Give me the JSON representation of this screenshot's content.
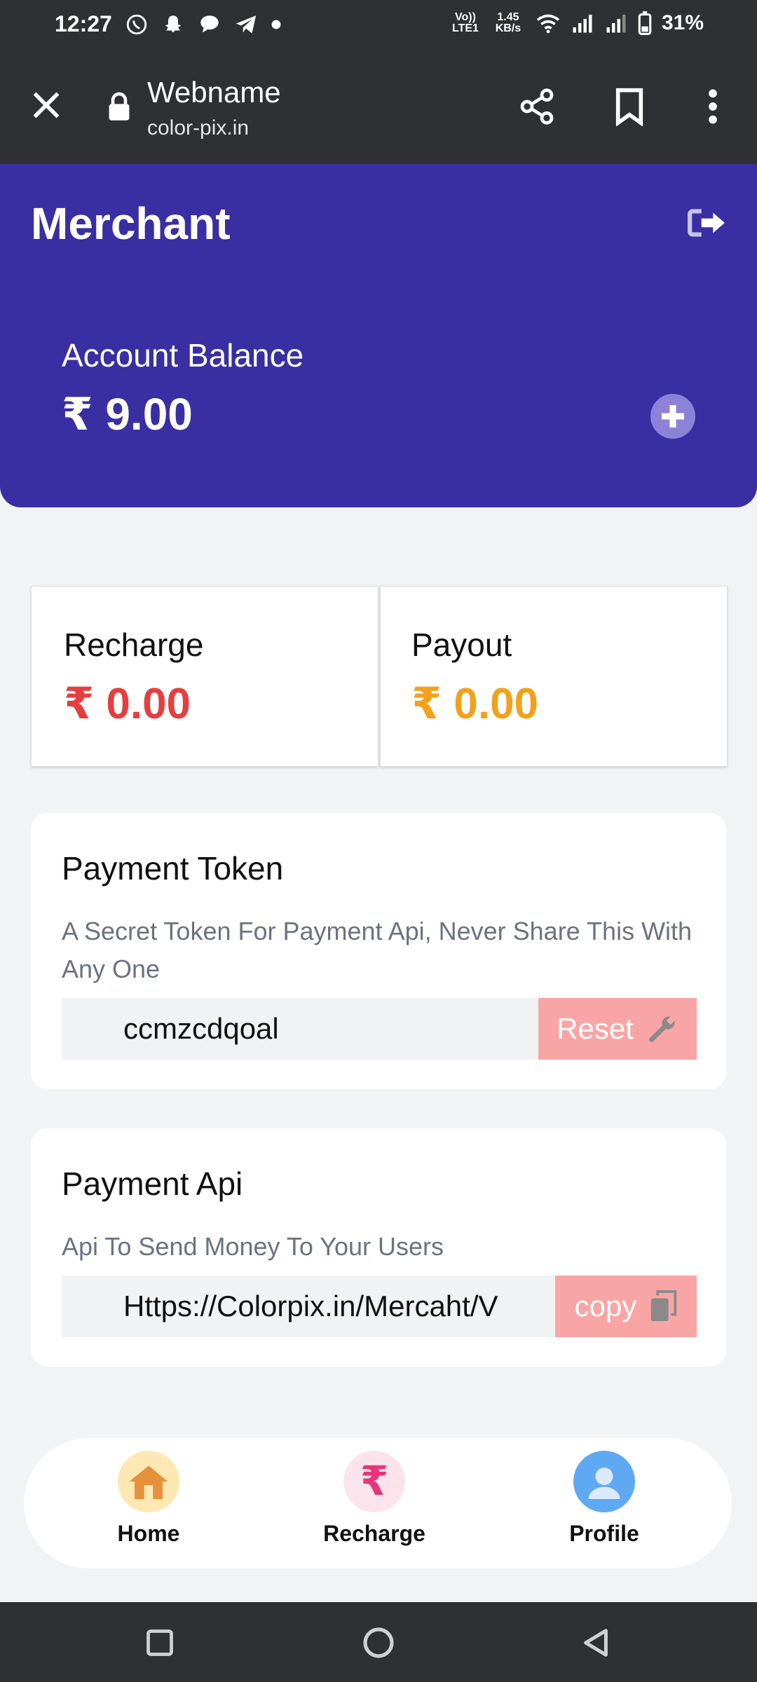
{
  "status_bar": {
    "time": "12:27",
    "volte": "Vo)) LTE1",
    "speed": "1.45 KB/s",
    "battery": "31%"
  },
  "browser": {
    "site_title": "Webname",
    "site_url": "color-pix.in"
  },
  "header": {
    "title": "Merchant",
    "balance_label": "Account Balance",
    "balance_value": "₹ 9.00"
  },
  "stats": {
    "recharge": {
      "label": "Recharge",
      "value": "₹ 0.00",
      "color": "#e53e3e"
    },
    "payout": {
      "label": "Payout",
      "value": "₹ 0.00",
      "color": "#f2a11a"
    }
  },
  "payment_token": {
    "title": "Payment Token",
    "description": "A Secret Token For Payment Api, Never Share This With Any One",
    "value": "ccmzcdqoal",
    "button": "Reset"
  },
  "payment_api": {
    "title": "Payment Api",
    "description": "Api To Send Money To Your Users",
    "value": "Https://Colorpix.in/Mercaht/V",
    "button": "copy"
  },
  "bottom_nav": {
    "home": "Home",
    "recharge": "Recharge",
    "profile": "Profile"
  },
  "colors": {
    "header_bg": "#3a2ea3",
    "action_btn": "#f9a5a5"
  }
}
